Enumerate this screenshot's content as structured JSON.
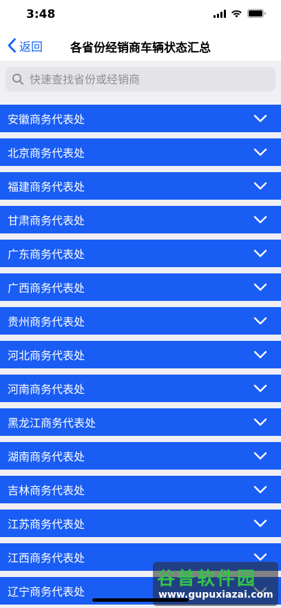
{
  "status_bar": {
    "time": "3:48"
  },
  "nav": {
    "back_label": "返回",
    "title": "各省份经销商车辆状态汇总"
  },
  "search": {
    "placeholder": "快速查找省份或经销商"
  },
  "list": {
    "items": [
      {
        "label": "安徽商务代表处"
      },
      {
        "label": "北京商务代表处"
      },
      {
        "label": "福建商务代表处"
      },
      {
        "label": "甘肃商务代表处"
      },
      {
        "label": "广东商务代表处"
      },
      {
        "label": "广西商务代表处"
      },
      {
        "label": "贵州商务代表处"
      },
      {
        "label": "河北商务代表处"
      },
      {
        "label": "河南商务代表处"
      },
      {
        "label": "黑龙江商务代表处"
      },
      {
        "label": "湖南商务代表处"
      },
      {
        "label": "吉林商务代表处"
      },
      {
        "label": "江苏商务代表处"
      },
      {
        "label": "江西商务代表处"
      },
      {
        "label": "辽宁商务代表处"
      }
    ]
  },
  "watermark": {
    "title": "谷普软件园",
    "url": "www.gupuxiazai.com"
  },
  "colors": {
    "accent": "#1565f0",
    "row_background": "#1a5df4",
    "list_background": "#efeff4"
  }
}
